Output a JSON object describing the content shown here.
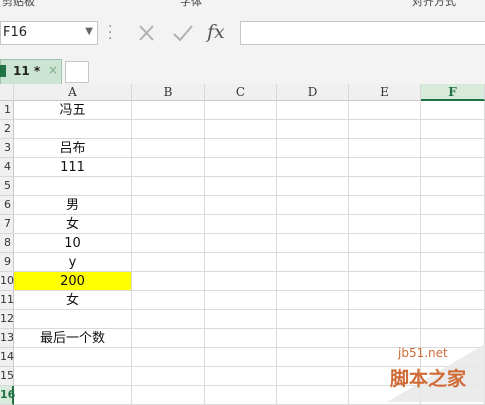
{
  "ribbon_groups": [
    "剪贴板",
    "字体",
    "对齐方式"
  ],
  "formula_bar": {
    "name_box": "F16",
    "cancel_icon": "×",
    "enter_icon": "✓",
    "fx_label": "fx",
    "formula": ""
  },
  "sheet_tab": {
    "label": "11 *",
    "close": "×"
  },
  "columns": [
    "A",
    "B",
    "C",
    "D",
    "E",
    "F"
  ],
  "selected_column": "F",
  "rows": [
    "1",
    "2",
    "3",
    "4",
    "5",
    "6",
    "7",
    "8",
    "9",
    "10",
    "11",
    "12",
    "13",
    "14",
    "15",
    "16"
  ],
  "selected_row": "16",
  "column_a_values": [
    "冯五",
    "",
    "吕布",
    "111",
    "",
    "男",
    "女",
    "10",
    "y",
    "200",
    "女",
    "",
    "最后一个数",
    "",
    "",
    ""
  ],
  "highlighted_row": "10",
  "highlight_color": "#ffff00",
  "watermark": {
    "site": "jb51.net",
    "brand": "脚本之家"
  }
}
